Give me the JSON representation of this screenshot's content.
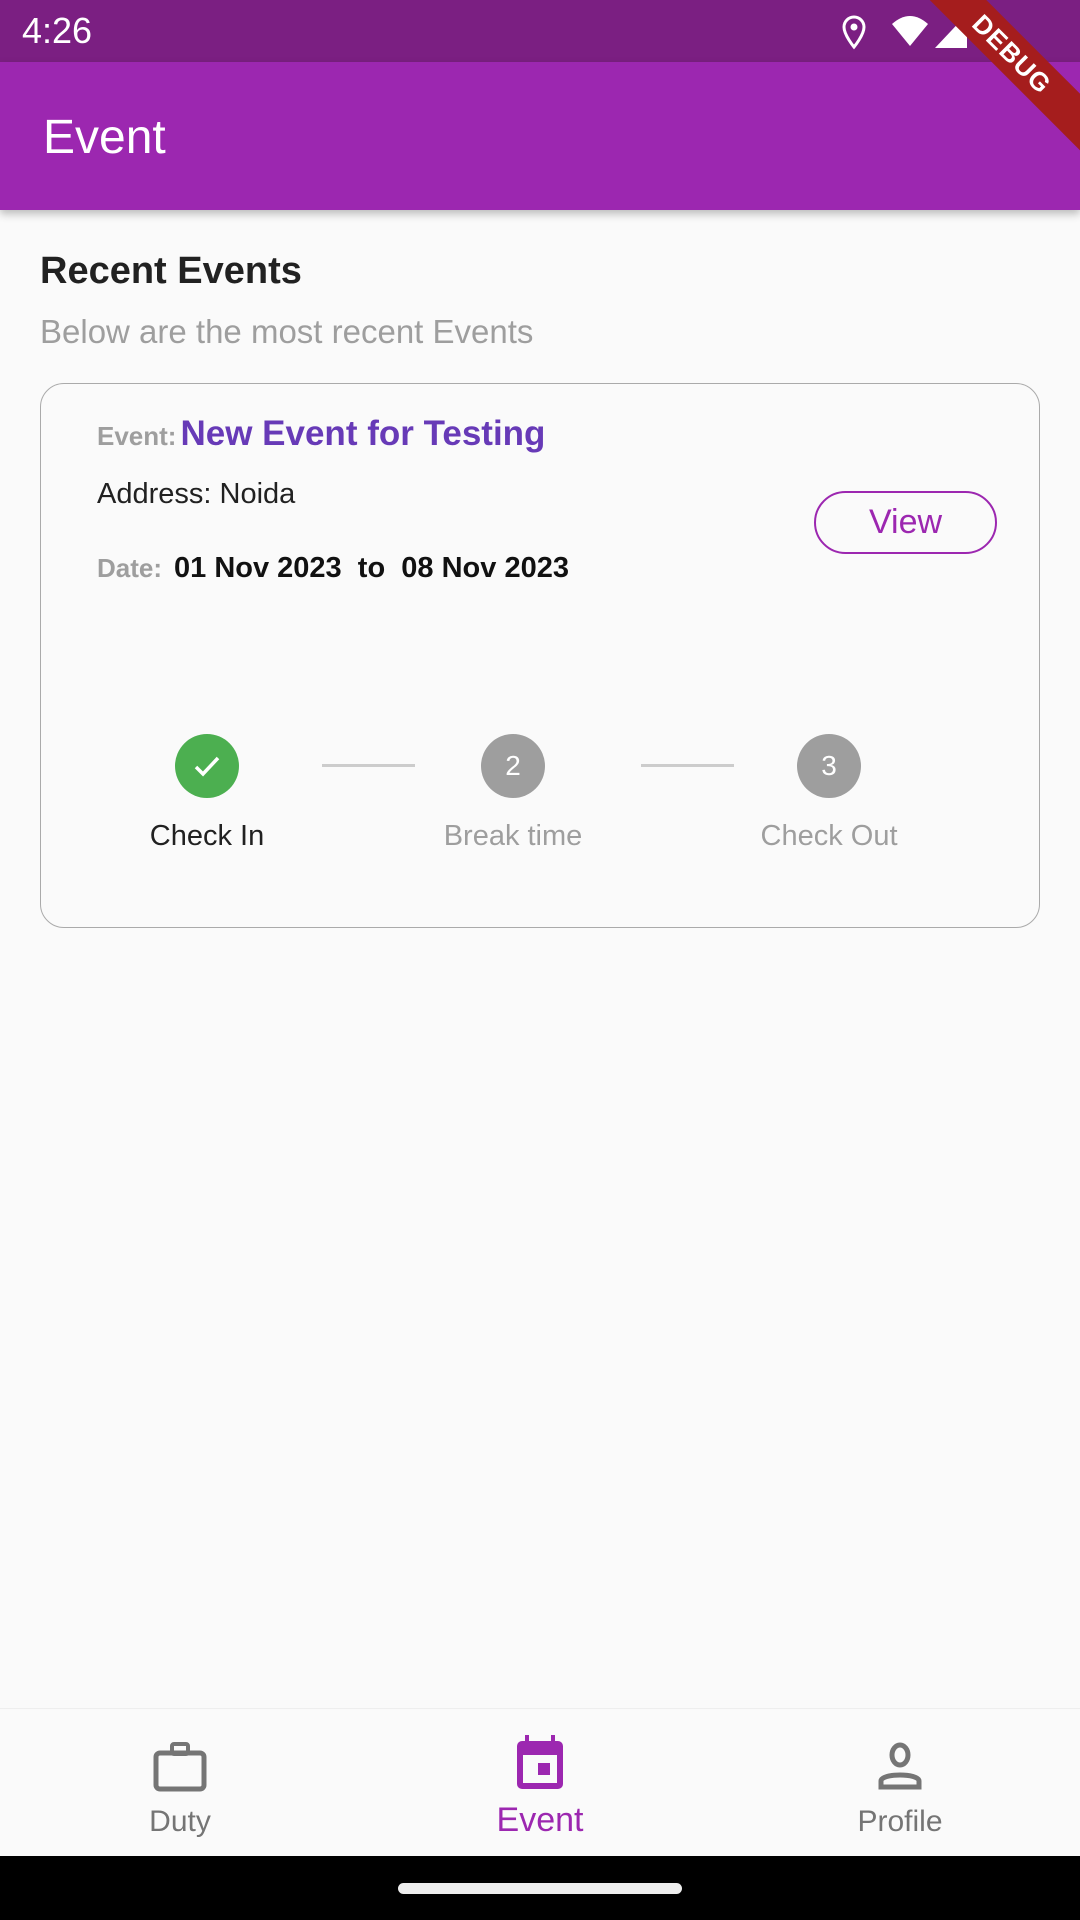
{
  "status_bar": {
    "time": "4:26",
    "icons": [
      "location-icon",
      "wifi-icon",
      "signal-icon"
    ]
  },
  "debug_banner": "DEBUG",
  "app_bar": {
    "title": "Event",
    "color": "#9c27b0"
  },
  "section": {
    "title": "Recent Events",
    "subtitle": "Below are the most recent Events"
  },
  "event_card": {
    "event_label": "Event:",
    "event_name": "New Event for Testing",
    "address": "Address: Noida",
    "date_label": "Date:",
    "date_range": "01 Nov 2023  to  08 Nov 2023",
    "view_label": "View",
    "steps": [
      {
        "label": "Check In",
        "marker": "✓",
        "status": "completed",
        "color": "#4caf50"
      },
      {
        "label": "Break time",
        "marker": "2",
        "status": "pending",
        "color": "#9e9e9e"
      },
      {
        "label": "Check Out",
        "marker": "3",
        "status": "pending",
        "color": "#9e9e9e"
      }
    ]
  },
  "bottom_nav": {
    "items": [
      {
        "label": "Duty",
        "icon": "briefcase-icon",
        "active": false
      },
      {
        "label": "Event",
        "icon": "calendar-icon",
        "active": true
      },
      {
        "label": "Profile",
        "icon": "person-icon",
        "active": false
      }
    ]
  }
}
